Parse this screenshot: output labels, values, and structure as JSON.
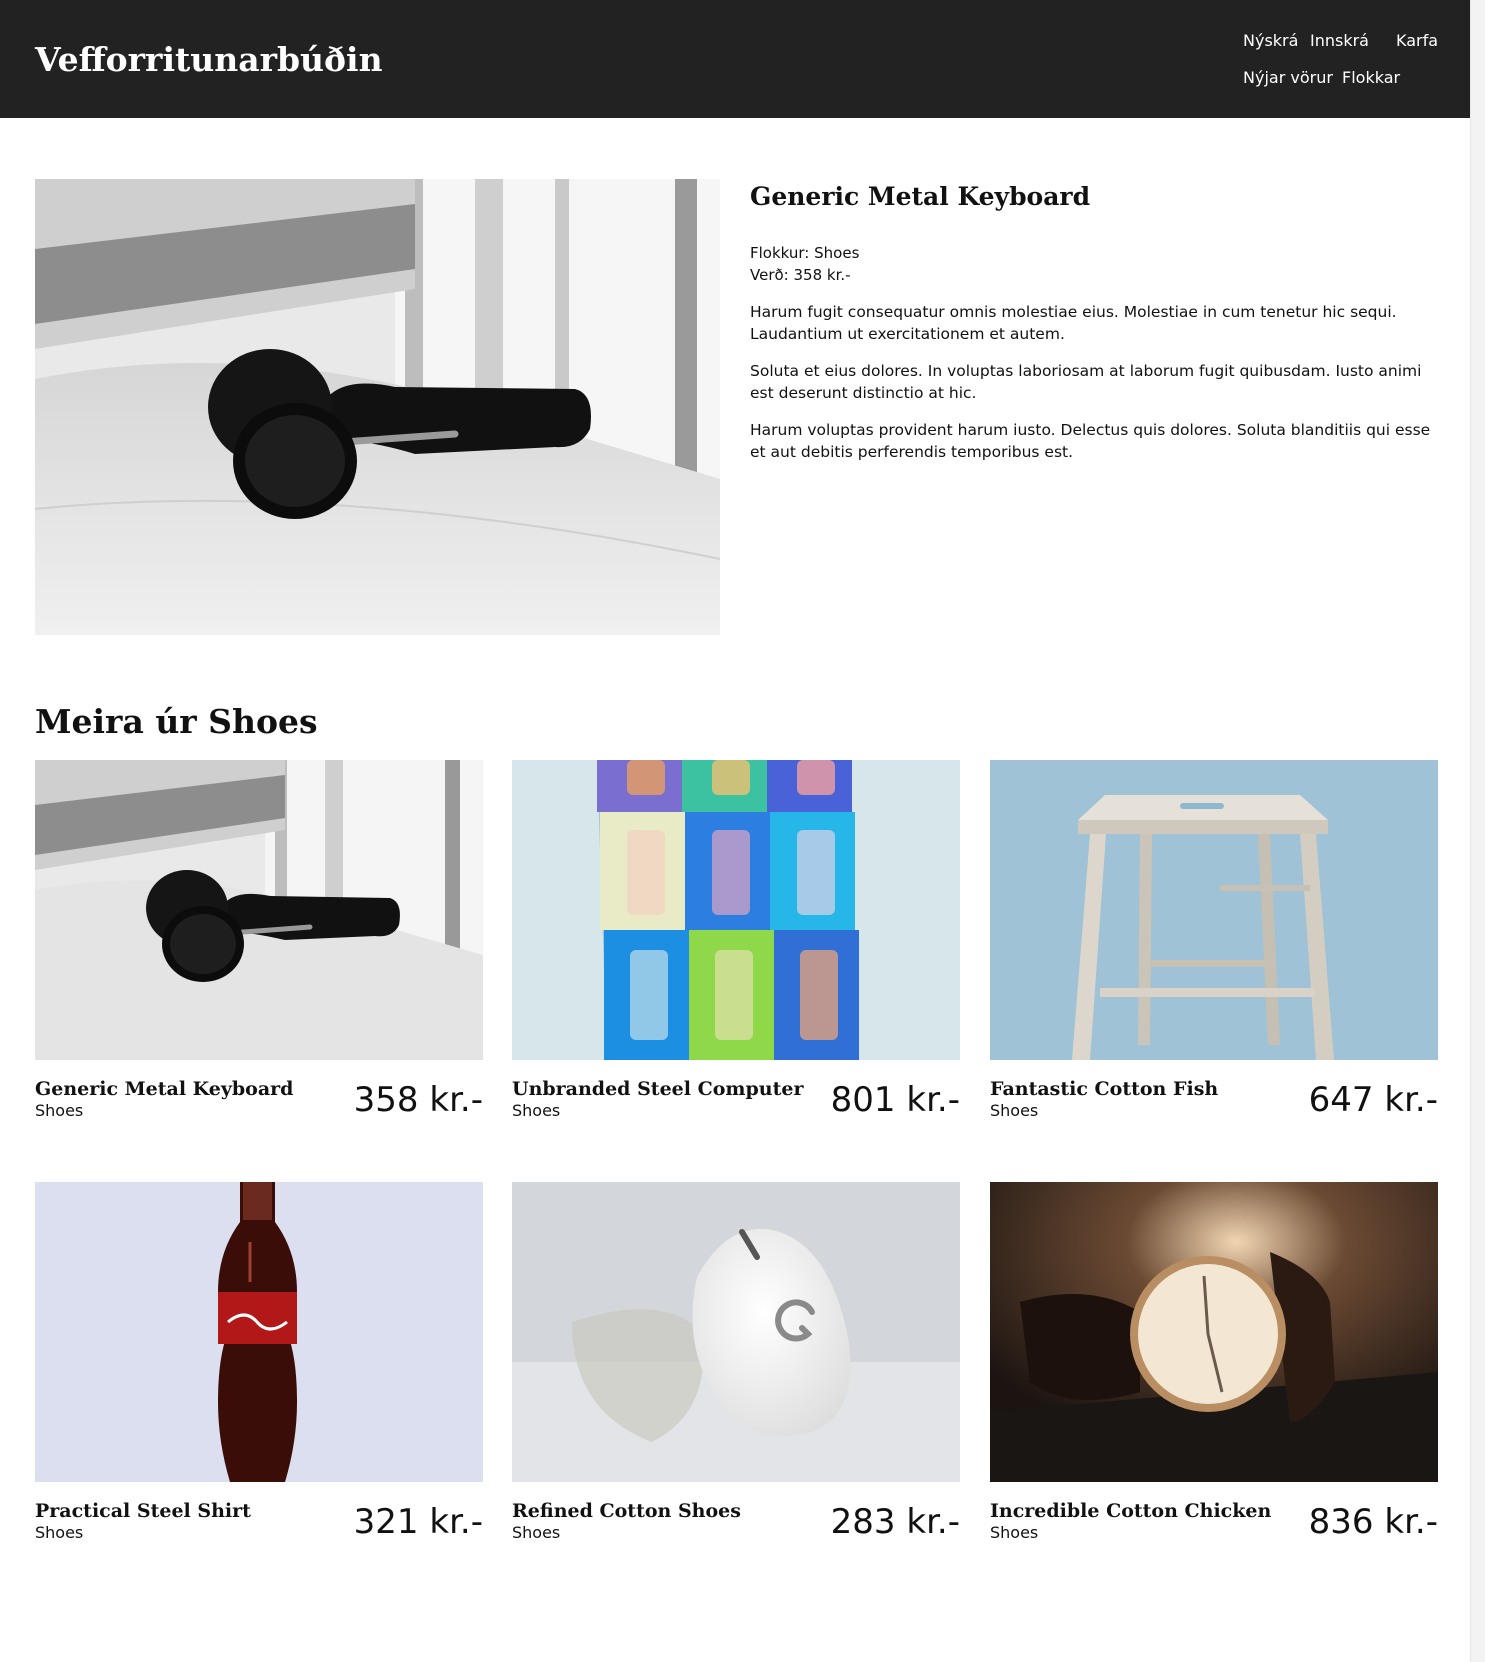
{
  "header": {
    "brand": "Vefforritunarbúðin",
    "nav": {
      "signup": "Nýskrá",
      "login": "Innskrá",
      "cart": "Karfa",
      "new_products": "Nýjar vörur",
      "categories": "Flokkar"
    }
  },
  "product": {
    "title": "Generic Metal Keyboard",
    "category_label": "Flokkur:",
    "category": "Shoes",
    "price_label": "Verð:",
    "price": "358 kr.-",
    "image": "headphones-on-pillow",
    "description": [
      "Harum fugit consequatur omnis molestiae eius. Molestiae in cum tenetur hic sequi. Laudantium ut exercitationem et autem.",
      "Soluta et eius dolores. In voluptas laboriosam at laborum fugit quibusdam. Iusto animi est deserunt distinctio at hic.",
      "Harum voluptas provident harum iusto. Delectus quis dolores. Soluta blanditiis qui esse et aut debitis perferendis temporibus est."
    ]
  },
  "related": {
    "title": "Meira úr Shoes",
    "items": [
      {
        "title": "Generic Metal Keyboard",
        "category": "Shoes",
        "price": "358 kr.-",
        "image": "headphones-on-pillow"
      },
      {
        "title": "Unbranded Steel Computer",
        "category": "Shoes",
        "price": "801 kr.-",
        "image": "colorful-speaker-grid"
      },
      {
        "title": "Fantastic Cotton Fish",
        "category": "Shoes",
        "price": "647 kr.-",
        "image": "wooden-stool"
      },
      {
        "title": "Practical Steel Shirt",
        "category": "Shoes",
        "price": "321 kr.-",
        "image": "cola-bottle"
      },
      {
        "title": "Refined Cotton Shoes",
        "category": "Shoes",
        "price": "283 kr.-",
        "image": "white-mouse"
      },
      {
        "title": "Incredible Cotton Chicken",
        "category": "Shoes",
        "price": "836 kr.-",
        "image": "wrist-watch"
      }
    ]
  },
  "colors": {
    "header_bg": "#222222",
    "header_text": "#ffffff",
    "text": "#111111",
    "page_bg": "#ffffff"
  }
}
